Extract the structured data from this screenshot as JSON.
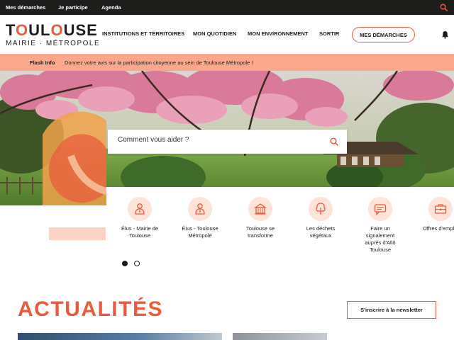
{
  "topbar": {
    "links": [
      "Mes démarches",
      "Je participe",
      "Agenda"
    ]
  },
  "logo": {
    "line1_a": "T",
    "line1_o": "O",
    "line1_b": "UL",
    "line1_o2": "O",
    "line1_c": "USE",
    "line2": "MAIRIE · MÉTROPOLE"
  },
  "nav": {
    "items": [
      "INSTITUTIONS ET TERRITOIRES",
      "MON QUOTIDIEN",
      "MON ENVIRONNEMENT",
      "SORTIR"
    ],
    "cta": "MES DÉMARCHES"
  },
  "flash": {
    "label": "Flash Info",
    "text": "Donnez votre avis sur la participation citoyenne au sein de Toulouse Métropole !"
  },
  "search": {
    "placeholder": "Comment vous aider ?"
  },
  "quick_access": [
    {
      "label": "Élus - Mairie de Toulouse",
      "icon": "person-icon"
    },
    {
      "label": "Élus - Toulouse Métropole",
      "icon": "person-icon"
    },
    {
      "label": "Toulouse se transforme",
      "icon": "building-icon"
    },
    {
      "label": "Les déchets végétaux",
      "icon": "tree-icon"
    },
    {
      "label": "Faire un signalement auprès d'Allô Toulouse",
      "icon": "chat-icon"
    },
    {
      "label": "Offres d'emploi",
      "icon": "briefcase-icon"
    }
  ],
  "carousel": {
    "active_index": 0,
    "count": 2
  },
  "news": {
    "title": "ACTUALITÉS",
    "newsletter_button": "S'inscrire à la newsletter"
  },
  "colors": {
    "accent": "#e85c3d",
    "flash_bg": "#f9a88e",
    "icon_bg": "#fde3d8",
    "topbar_bg": "#1d1d1b"
  }
}
